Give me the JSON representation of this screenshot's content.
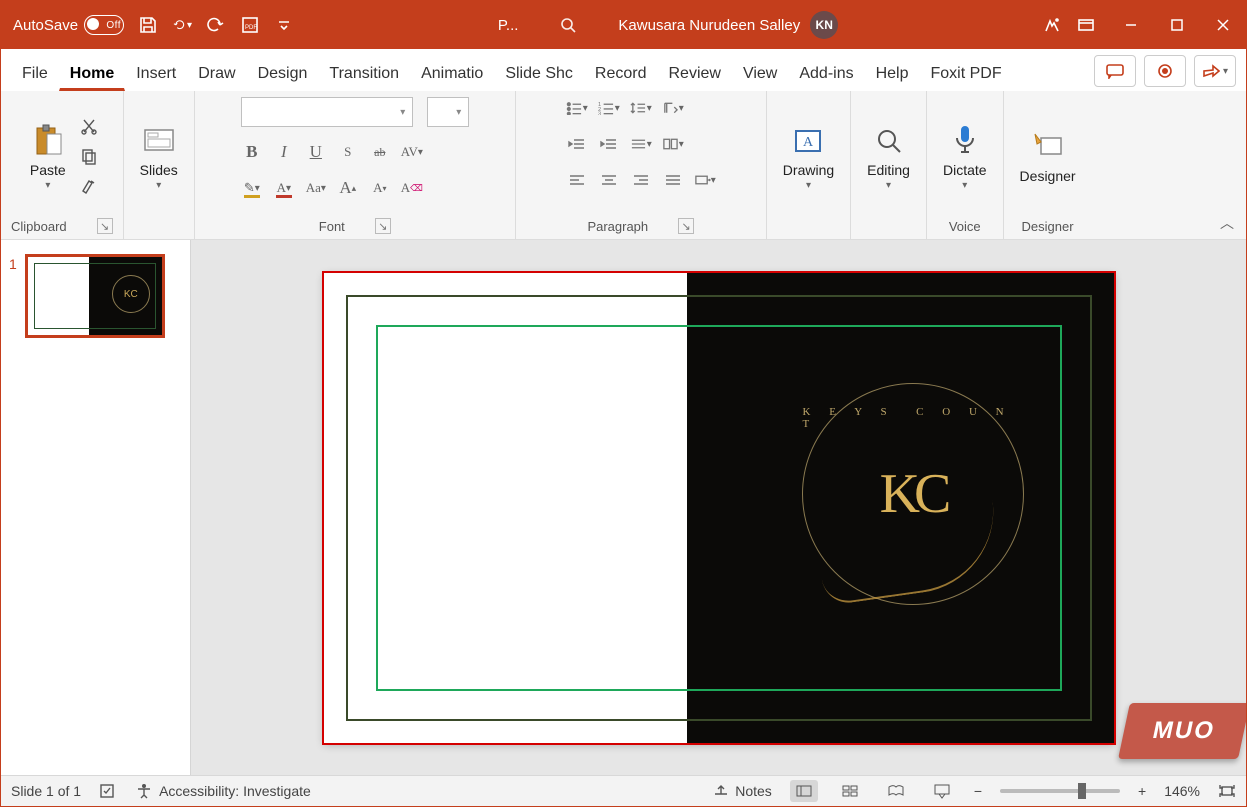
{
  "titlebar": {
    "autosave_label": "AutoSave",
    "autosave_state": "Off",
    "app_initial": "P...",
    "user_name": "Kawusara Nurudeen Salley",
    "user_initials": "KN"
  },
  "tabs": {
    "file": "File",
    "items": [
      "Home",
      "Insert",
      "Draw",
      "Design",
      "Transitions",
      "Animations",
      "Slide Show",
      "Record",
      "Review",
      "View",
      "Add-ins",
      "Help",
      "Foxit PDF"
    ],
    "display": [
      "Home",
      "Insert",
      "Draw",
      "Design",
      "Transition",
      "Animatio",
      "Slide Shc",
      "Record",
      "Review",
      "View",
      "Add-ins",
      "Help",
      "Foxit PDF"
    ],
    "active_index": 0
  },
  "ribbon": {
    "clipboard": {
      "paste": "Paste",
      "label": "Clipboard"
    },
    "slides": {
      "label": "Slides",
      "btn": "Slides"
    },
    "font": {
      "label": "Font",
      "grow": "A",
      "shrink": "A",
      "spacing": "AV",
      "case": "Aa",
      "bold": "B",
      "italic": "I",
      "underline": "U",
      "shadow": "S",
      "strike": "ab"
    },
    "paragraph": {
      "label": "Paragraph"
    },
    "drawing": {
      "label": "Drawing",
      "btn": "Drawing"
    },
    "editing": {
      "label": "Editing",
      "btn": "Editing"
    },
    "voice": {
      "label": "Voice",
      "btn": "Dictate"
    },
    "designer": {
      "label": "Designer",
      "btn": "Designer"
    }
  },
  "thumbs": {
    "n1": "1"
  },
  "logo": {
    "top_text": "K E Y S",
    "right_text": "C O U N T",
    "monogram": "KC"
  },
  "statusbar": {
    "slide_info": "Slide 1 of 1",
    "accessibility": "Accessibility: Investigate",
    "notes": "Notes",
    "zoom_pct": "146%"
  },
  "watermark": "MUO"
}
